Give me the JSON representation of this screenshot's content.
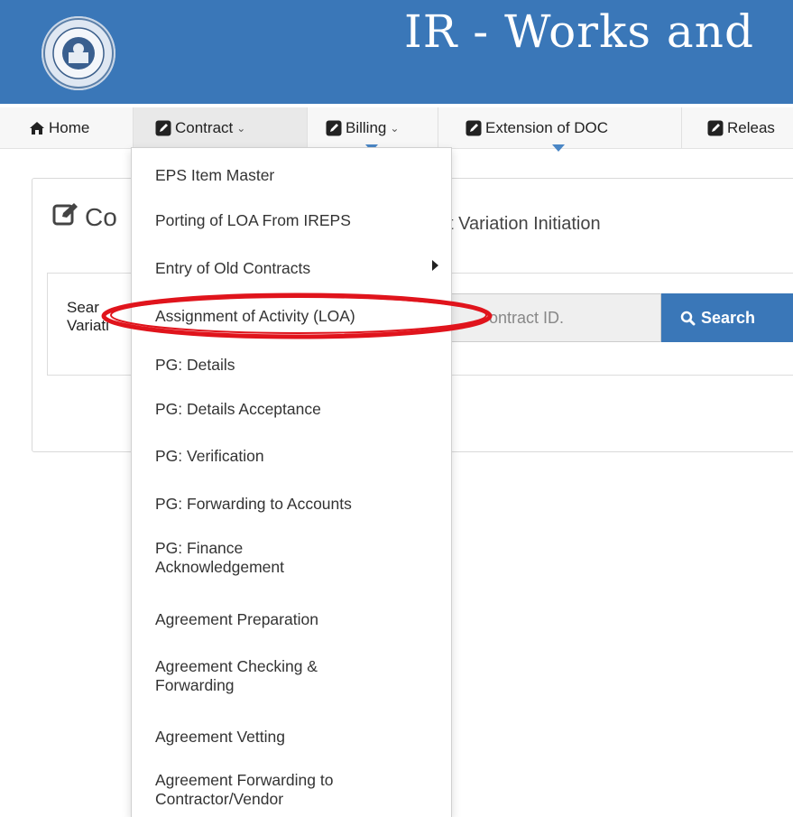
{
  "header": {
    "title": "IR - Works and",
    "logo_icon": "indian-railways-logo"
  },
  "nav": {
    "items": [
      {
        "label": "Home",
        "icon": "home-icon",
        "has_caret": false
      },
      {
        "label": "Contract",
        "icon": "edit-icon",
        "has_caret": true
      },
      {
        "label": "Billing",
        "icon": "edit-icon",
        "has_caret": true
      },
      {
        "label": "Extension of DOC",
        "icon": "edit-icon",
        "has_caret": false
      },
      {
        "label": "Releas",
        "icon": "edit-icon",
        "has_caret": false
      }
    ]
  },
  "panel": {
    "title": "Co",
    "subtitle": "t Variation Initiation",
    "search_label": "Sear\nVariati",
    "search_placeholder": "ontract ID.",
    "search_button": "Search"
  },
  "dropdown": {
    "items": [
      {
        "label": "EPS Item Master"
      },
      {
        "label": "Porting of LOA From IREPS"
      },
      {
        "label": "Entry of Old Contracts",
        "submenu": true
      },
      {
        "label": "Assignment of Activity (LOA)",
        "highlighted": true
      },
      {
        "label": "PG: Details"
      },
      {
        "label": "PG: Details Acceptance"
      },
      {
        "label": "PG: Verification"
      },
      {
        "label": "PG: Forwarding to Accounts"
      },
      {
        "label": "PG: Finance\nAcknowledgement"
      },
      {
        "label": "Agreement Preparation"
      },
      {
        "label": "Agreement Checking &\nForwarding"
      },
      {
        "label": "Agreement Vetting"
      },
      {
        "label": "Agreement Forwarding to\nContractor/Vendor"
      }
    ]
  },
  "colors": {
    "header_blue": "#3a77b8",
    "annotation_red": "#e0141c"
  }
}
